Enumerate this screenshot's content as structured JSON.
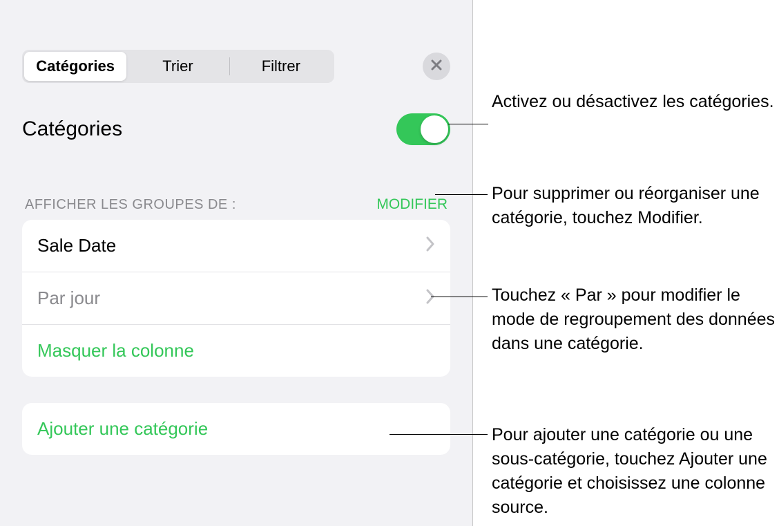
{
  "tabs": {
    "categories": "Catégories",
    "sort": "Trier",
    "filter": "Filtrer"
  },
  "section": {
    "title": "Catégories"
  },
  "groups": {
    "label": "AFFICHER LES GROUPES DE :",
    "edit": "MODIFIER",
    "primary": "Sale Date",
    "by": "Par jour",
    "hide": "Masquer la colonne"
  },
  "add": {
    "label": "Ajouter une catégorie"
  },
  "callouts": {
    "toggle": "Activez ou désactivez les catégories.",
    "edit": "Pour supprimer ou réorganiser une catégorie, touchez Modifier.",
    "by": "Touchez « Par » pour modifier le mode de regroupement des données dans une catégorie.",
    "add": "Pour ajouter une catégorie ou une sous-catégorie, touchez Ajouter une catégorie et choisissez une colonne source."
  }
}
